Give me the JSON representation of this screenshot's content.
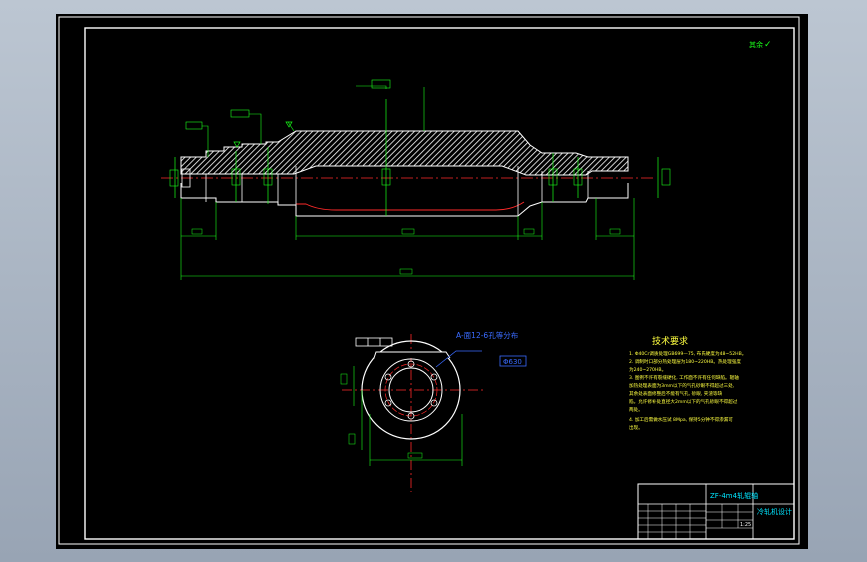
{
  "drawing": {
    "corner_note": "其余",
    "corner_symbol": "✓",
    "section_label": "A-面12-6孔等分布",
    "section_box": "Φ630",
    "tech": {
      "title": "技术要求",
      "lines": [
        "1. Φ40Cr调质处理GB699—75, 布氏硬度为48~52HB。",
        "2. 调制时口部分热处理层为180~220HB。热处理强度",
        "为240~270HB。",
        "3. 图例不许有裂缝硬化, 工作面不许有任何缺陷。辊轴",
        "加热处理表面为3mm以下的气孔砂眼不得超过三处,",
        "其余处表面修整后不能有气孔, 砂眼, 夹渣等缺",
        "陷。允许修补处直径大2mm以下的气孔砂眼不得超过",
        "两处。",
        "4. 加工后需做水压试 8Mpa, 保持5分钟不得渗漏可",
        "出现。"
      ]
    },
    "title_block": {
      "part_name": "ZF-4m4轧辊轴",
      "drawing_name": "冷轧机设计",
      "scale": "1:25"
    }
  },
  "colors": {
    "green": "#19ff19",
    "cyan": "#00e5ff",
    "white": "#ffffff",
    "red": "#ff2a2a",
    "blue": "#3a6bff",
    "yellow": "#ffff40"
  }
}
